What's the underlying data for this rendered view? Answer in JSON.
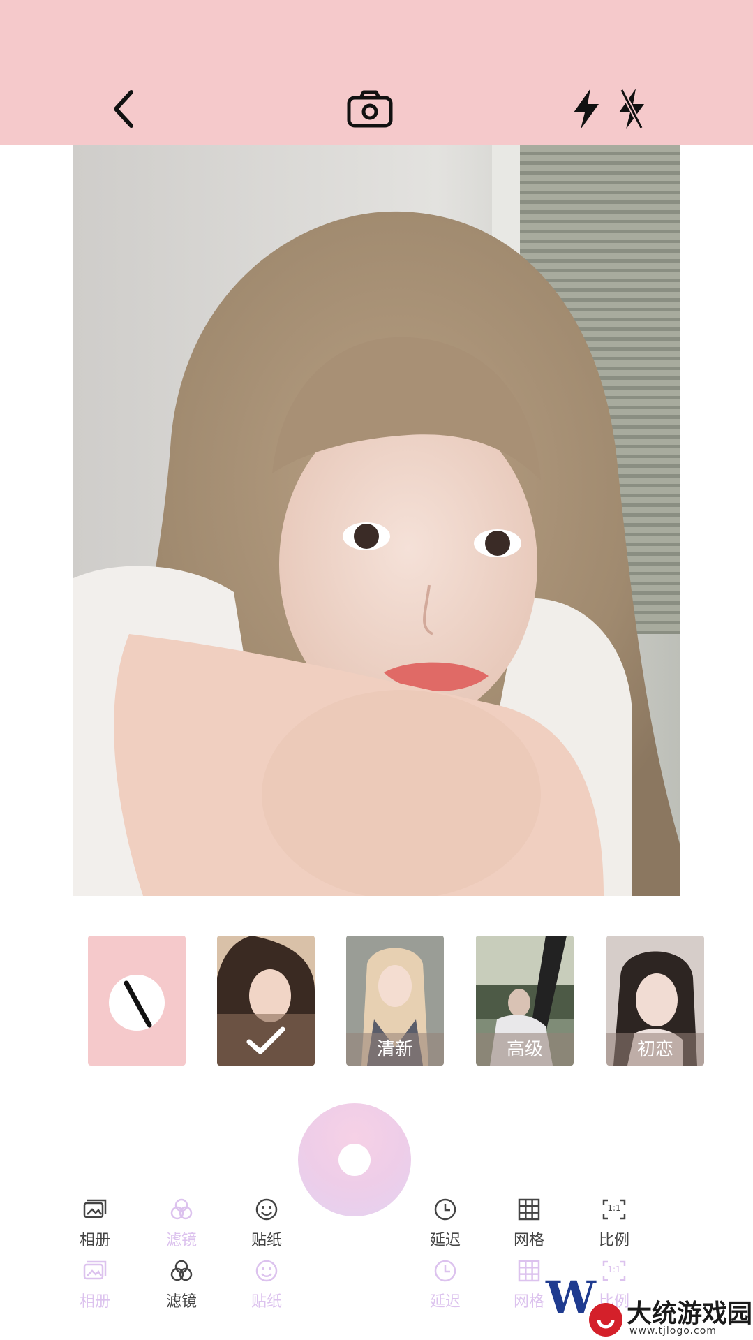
{
  "header": {
    "back_icon": "chevron-left-icon",
    "camera_icon": "camera-icon",
    "flash_icon": "flash-icon",
    "flash_off_icon": "flash-off-icon",
    "background": "#f5c9cb"
  },
  "filters": {
    "items": [
      {
        "name": "none",
        "label": "",
        "icon": "no-filter-icon"
      },
      {
        "name": "selected",
        "label": "",
        "icon": "checkmark-icon",
        "selected": true
      },
      {
        "name": "fresh",
        "label": "清新"
      },
      {
        "name": "premium",
        "label": "高级"
      },
      {
        "name": "first-love",
        "label": "初恋"
      }
    ]
  },
  "toolbar_primary": [
    {
      "label": "相册",
      "icon": "album-icon"
    },
    {
      "label": "滤镜",
      "icon": "filter-icon",
      "active": true
    },
    {
      "label": "贴纸",
      "icon": "sticker-icon"
    },
    {
      "label": "延迟",
      "icon": "timer-icon"
    },
    {
      "label": "网格",
      "icon": "grid-icon"
    },
    {
      "label": "比例",
      "icon": "ratio-icon",
      "badge": "1:1"
    }
  ],
  "toolbar_secondary": [
    {
      "label": "相册",
      "icon": "album-icon"
    },
    {
      "label": "滤镜",
      "icon": "filter-icon"
    },
    {
      "label": "贴纸",
      "icon": "sticker-icon"
    },
    {
      "label": "延迟",
      "icon": "timer-icon"
    },
    {
      "label": "网格",
      "icon": "grid-icon"
    },
    {
      "label": "比例",
      "icon": "ratio-icon",
      "badge": "1:1"
    }
  ],
  "watermark": {
    "brand": "大统游戏园",
    "url": "www.tjlogo.com"
  },
  "colors": {
    "accent": "#f5c9cb",
    "active_tool": "#dcc2ee",
    "shutter_a": "#f6d1e6",
    "shutter_b": "#e4d2f1"
  }
}
